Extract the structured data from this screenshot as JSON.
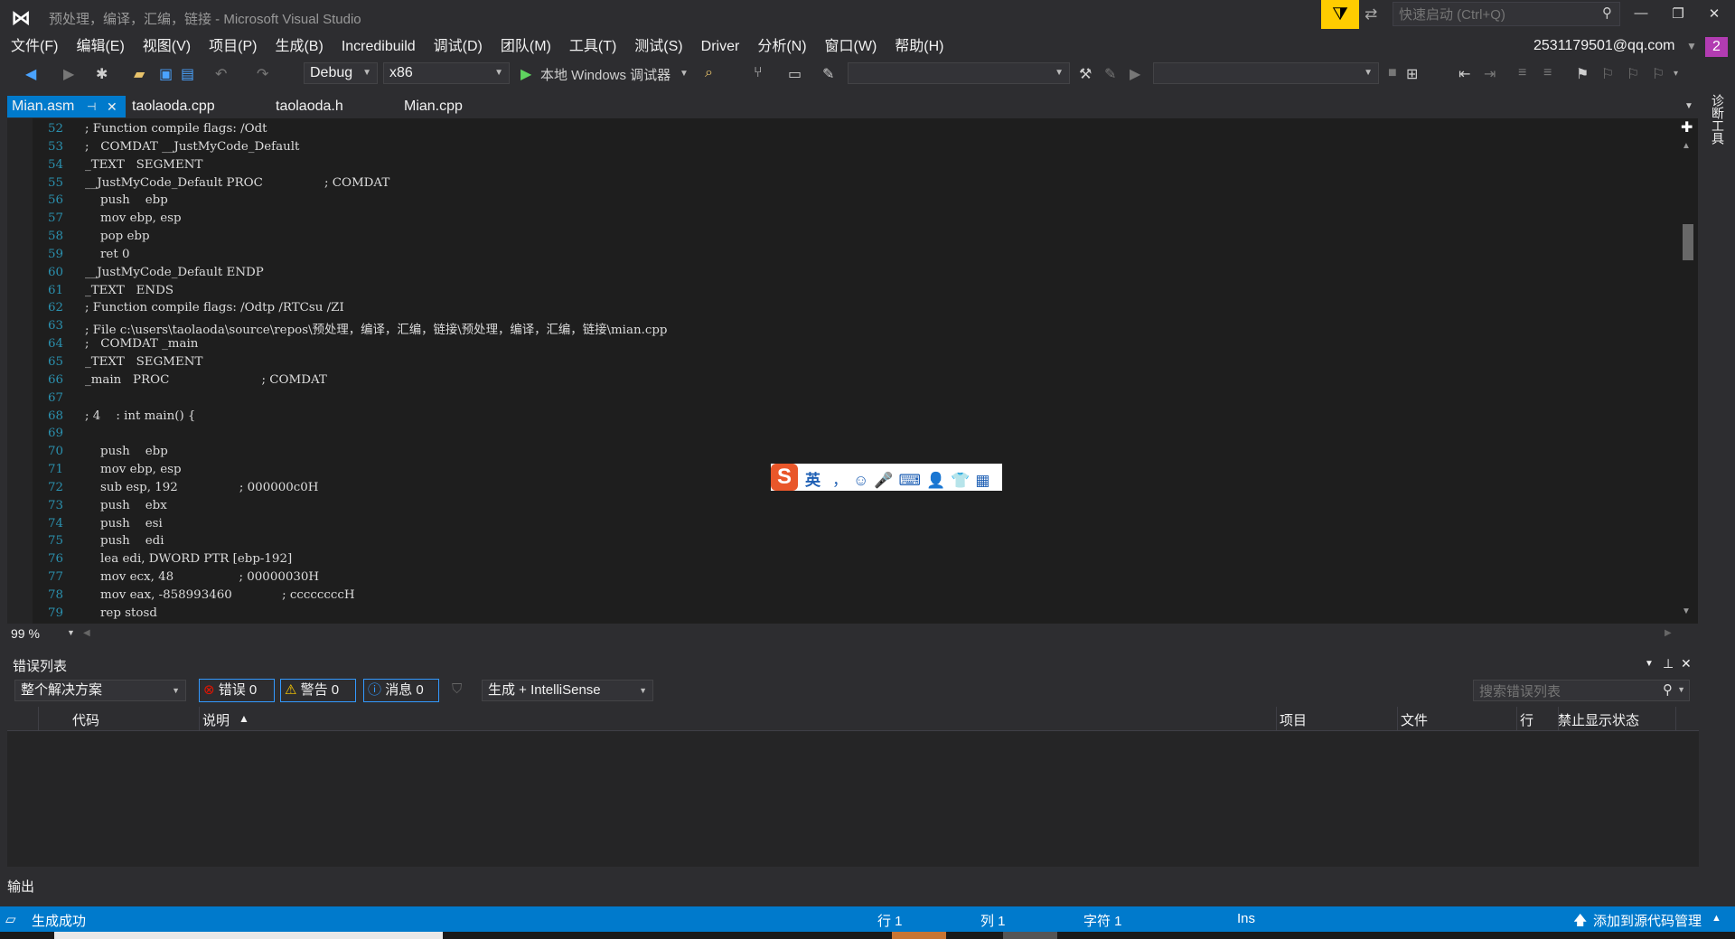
{
  "window": {
    "title": "预处理，编译，汇编，链接 - Microsoft Visual Studio",
    "quick_launch_placeholder": "快速启动 (Ctrl+Q)",
    "account": "2531179501@qq.com",
    "notification_count": "2"
  },
  "menu": [
    "文件(F)",
    "编辑(E)",
    "视图(V)",
    "项目(P)",
    "生成(B)",
    "Incredibuild",
    "调试(D)",
    "团队(M)",
    "工具(T)",
    "测试(S)",
    "Driver",
    "分析(N)",
    "窗口(W)",
    "帮助(H)"
  ],
  "toolbar": {
    "config": "Debug",
    "platform": "x86",
    "debugger": "本地 Windows 调试器"
  },
  "tabs": [
    "Mian.asm",
    "taolaoda.cpp",
    "taolaoda.h",
    "Mian.cpp"
  ],
  "editor": {
    "zoom": "99 %",
    "lines": [
      {
        "n": "52",
        "t": "; Function compile flags: /Odt"
      },
      {
        "n": "53",
        "t": ";   COMDAT __JustMyCode_Default"
      },
      {
        "n": "54",
        "t": "_TEXT   SEGMENT"
      },
      {
        "n": "55",
        "t": "__JustMyCode_Default PROC                ; COMDAT"
      },
      {
        "n": "56",
        "t": "    push    ebp"
      },
      {
        "n": "57",
        "t": "    mov ebp, esp"
      },
      {
        "n": "58",
        "t": "    pop ebp"
      },
      {
        "n": "59",
        "t": "    ret 0"
      },
      {
        "n": "60",
        "t": "__JustMyCode_Default ENDP"
      },
      {
        "n": "61",
        "t": "_TEXT   ENDS"
      },
      {
        "n": "62",
        "t": "; Function compile flags: /Odtp /RTCsu /ZI"
      },
      {
        "n": "63",
        "t": "; File c:\\users\\taolaoda\\source\\repos\\预处理，编译，汇编，链接\\预处理，编译，汇编，链接\\mian.cpp"
      },
      {
        "n": "64",
        "t": ";   COMDAT _main"
      },
      {
        "n": "65",
        "t": "_TEXT   SEGMENT"
      },
      {
        "n": "66",
        "t": "_main   PROC                        ; COMDAT"
      },
      {
        "n": "67",
        "t": ""
      },
      {
        "n": "68",
        "t": "; 4    : int main() {"
      },
      {
        "n": "69",
        "t": ""
      },
      {
        "n": "70",
        "t": "    push    ebp"
      },
      {
        "n": "71",
        "t": "    mov ebp, esp"
      },
      {
        "n": "72",
        "t": "    sub esp, 192                ; 000000c0H"
      },
      {
        "n": "73",
        "t": "    push    ebx"
      },
      {
        "n": "74",
        "t": "    push    esi"
      },
      {
        "n": "75",
        "t": "    push    edi"
      },
      {
        "n": "76",
        "t": "    lea edi, DWORD PTR [ebp-192]"
      },
      {
        "n": "77",
        "t": "    mov ecx, 48                 ; 00000030H"
      },
      {
        "n": "78",
        "t": "    mov eax, -858993460             ; ccccccccH"
      },
      {
        "n": "79",
        "t": "    rep stosd"
      }
    ]
  },
  "ime": {
    "logo": "S",
    "lang": "英",
    "tools": "，☺🎤⌨👤👕▦"
  },
  "error_list": {
    "title": "错误列表",
    "scope": "整个解决方案",
    "errors_label": "错误 0",
    "warnings_label": "警告 0",
    "messages_label": "消息 0",
    "build_filter": "生成 + IntelliSense",
    "search_placeholder": "搜索错误列表",
    "columns": [
      "代码",
      "说明",
      "项目",
      "文件",
      "行",
      "禁止显示状态"
    ]
  },
  "output_tab": "输出",
  "side_tab": "诊断工具",
  "status": {
    "message": "生成成功",
    "line": "行 1",
    "col": "列 1",
    "char": "字符 1",
    "mode": "Ins",
    "source_control": "添加到源代码管理"
  }
}
